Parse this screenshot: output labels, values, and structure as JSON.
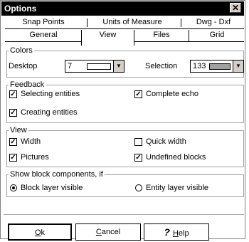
{
  "window": {
    "title": "Options",
    "close_label": "✕"
  },
  "tabs": {
    "row1": [
      "Snap Points",
      "Units of Measure",
      "Dwg - Dxf"
    ],
    "row2": [
      "General",
      "View",
      "Files",
      "Grid"
    ],
    "active": "View"
  },
  "colors_group": {
    "legend": "Colors",
    "desktop_label": "Desktop",
    "desktop_value": "7",
    "desktop_color": "#ffffff",
    "selection_label": "Selection",
    "selection_value": "133",
    "selection_color": "#a0a0a0"
  },
  "feedback_group": {
    "legend": "Feedback",
    "selecting_entities": {
      "label": "Selecting entities",
      "checked": true
    },
    "complete_echo": {
      "label": "Complete echo",
      "checked": true
    },
    "creating_entities": {
      "label": "Creating entities",
      "checked": true
    }
  },
  "view_group": {
    "legend": "View",
    "width": {
      "label": "Width",
      "checked": true
    },
    "quick_width": {
      "label": "Quick width",
      "checked": false
    },
    "pictures": {
      "label": "Pictures",
      "checked": true
    },
    "undefined_blocks": {
      "label": "Undefined blocks",
      "checked": true
    }
  },
  "block_group": {
    "legend": "Show block components, if",
    "block_layer_visible": {
      "label": "Block layer visible",
      "selected": true
    },
    "entity_layer_visible": {
      "label": "Entity layer visible",
      "selected": false
    }
  },
  "buttons": {
    "ok_first": "O",
    "ok_rest": "k",
    "cancel_first": "C",
    "cancel_rest": "ancel",
    "help_icon": "?",
    "help_first": "H",
    "help_rest": "elp"
  },
  "check_glyph": "✓"
}
